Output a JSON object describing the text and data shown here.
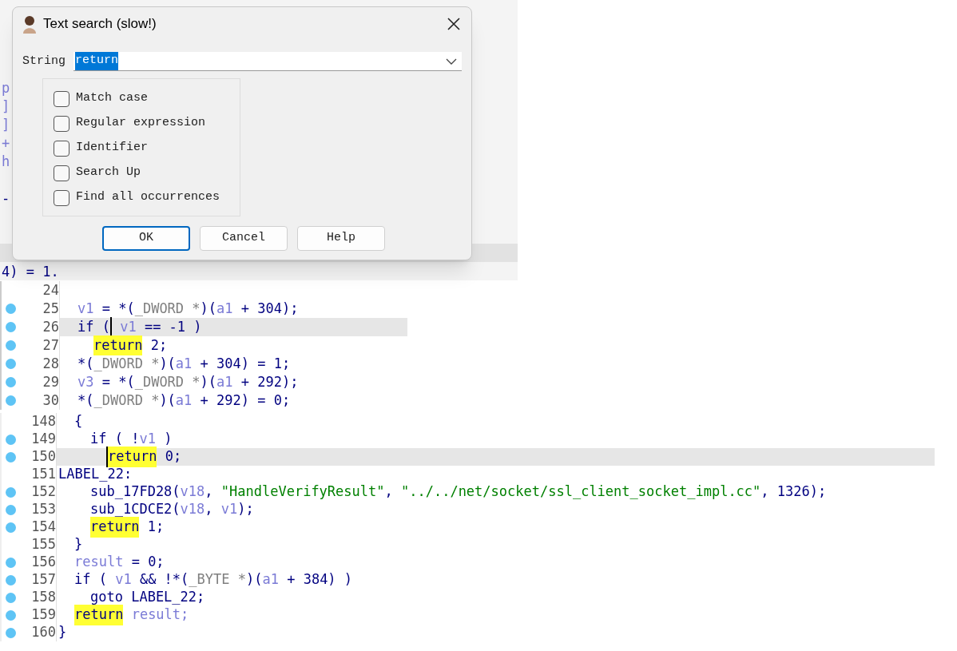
{
  "background_code": [
    {
      "kind": "blank"
    },
    {
      "kind": "blank"
    },
    {
      "kind": "blank"
    },
    {
      "kind": "blank"
    },
    {
      "kind": "var",
      "text": "p"
    },
    {
      "kind": "var",
      "text": "]"
    },
    {
      "kind": "var",
      "text": "]"
    },
    {
      "kind": "var",
      "text": "+"
    },
    {
      "kind": "var",
      "text": "h"
    },
    {
      "kind": "blank"
    },
    {
      "kind": "code",
      "text": "-"
    },
    {
      "kind": "blank"
    },
    {
      "kind": "blank"
    },
    {
      "kind": "current"
    },
    {
      "kind": "code",
      "text": "4) = 1."
    }
  ],
  "dialog": {
    "title": "Text search (slow!)",
    "string_label": "String",
    "string_value": "return",
    "options": [
      {
        "label": "Match case",
        "checked": false
      },
      {
        "label": "Regular expression",
        "checked": false
      },
      {
        "label": "Identifier",
        "checked": false
      },
      {
        "label": "Search Up",
        "checked": false
      },
      {
        "label": "Find all occurrences",
        "checked": false
      }
    ],
    "buttons": [
      {
        "label": "OK",
        "default": true
      },
      {
        "label": "Cancel",
        "default": false
      },
      {
        "label": "Help",
        "default": false
      }
    ]
  },
  "code_panels": [
    {
      "lines": [
        {
          "number": "24",
          "dot": false,
          "current": false
        },
        {
          "number": "25",
          "dot": true,
          "current": false,
          "kind": "single",
          "tokens": [
            {
              "t": "v1",
              "kind": "var"
            },
            {
              "t": " = *(",
              "kind": "code"
            },
            {
              "t": "_DWORD *",
              "kind": "type"
            },
            {
              "t": ")(",
              "kind": "code"
            },
            {
              "t": "a1",
              "kind": "var"
            },
            {
              "t": " + 304);",
              "kind": "code"
            }
          ]
        },
        {
          "number": "26",
          "dot": true,
          "current": true,
          "kind": "single",
          "tokens": [
            {
              "t": "if (",
              "kind": "code",
              "caret": false
            },
            {
              "t": " v1",
              "kind": "var",
              "caret": true
            },
            {
              "t": " == -1 )",
              "kind": "code",
              "caret": false
            }
          ]
        },
        {
          "number": "27",
          "dot": true,
          "current": false,
          "kind": "double",
          "tokens": [
            {
              "t": "return",
              "kind": "hit"
            },
            {
              "t": " 2;",
              "kind": "code"
            }
          ]
        },
        {
          "number": "28",
          "dot": true,
          "current": false,
          "kind": "single",
          "tokens": [
            {
              "t": "*(",
              "kind": "code"
            },
            {
              "t": "_DWORD *",
              "kind": "type"
            },
            {
              "t": ")(",
              "kind": "code"
            },
            {
              "t": "a1",
              "kind": "var"
            },
            {
              "t": " + 304) = 1;",
              "kind": "code"
            }
          ]
        },
        {
          "number": "29",
          "dot": true,
          "current": false,
          "kind": "single",
          "tokens": [
            {
              "t": "v3",
              "kind": "var"
            },
            {
              "t": " = *(",
              "kind": "code"
            },
            {
              "t": "_DWORD *",
              "kind": "type"
            },
            {
              "t": ")(",
              "kind": "code"
            },
            {
              "t": "a1",
              "kind": "var"
            },
            {
              "t": " + 292);",
              "kind": "code"
            }
          ]
        },
        {
          "number": "30",
          "dot": true,
          "current": false,
          "kind": "single",
          "tokens": [
            {
              "t": "*(",
              "kind": "code"
            },
            {
              "t": "_DWORD *",
              "kind": "type"
            },
            {
              "t": ")(",
              "kind": "code"
            },
            {
              "t": "a1",
              "kind": "var"
            },
            {
              "t": " + 292) = 0;",
              "kind": "code"
            }
          ]
        }
      ]
    },
    {
      "lines": [
        {
          "number": "148",
          "dot": false,
          "current": false,
          "kind": "single",
          "tokens": [
            {
              "t": "{",
              "kind": "code"
            }
          ]
        },
        {
          "number": "149",
          "dot": true,
          "current": false,
          "kind": "double",
          "tokens": [
            {
              "t": "if ( !",
              "kind": "code"
            },
            {
              "t": "v1",
              "kind": "var"
            },
            {
              "t": " )",
              "kind": "code"
            }
          ]
        },
        {
          "number": "150",
          "dot": true,
          "current": true,
          "kind": "triple",
          "tokens": [
            {
              "t": "return",
              "kind": "hit",
              "caret": true
            },
            {
              "t": " 0;",
              "kind": "code",
              "caret": false
            }
          ]
        },
        {
          "number": "151",
          "dot": false,
          "current": false,
          "kind": "flush",
          "tokens": [
            {
              "t": "LABEL_22:",
              "kind": "code"
            }
          ]
        },
        {
          "number": "152",
          "dot": true,
          "current": false,
          "kind": "double",
          "tokens": [
            {
              "t": "sub_17FD28(",
              "kind": "code"
            },
            {
              "t": "v18",
              "kind": "var"
            },
            {
              "t": ", ",
              "kind": "code"
            },
            {
              "t": "\"HandleVerifyResult\"",
              "kind": "str"
            },
            {
              "t": ", ",
              "kind": "code"
            },
            {
              "t": "\"../../net/socket/ssl_client_socket_impl.cc\"",
              "kind": "str"
            },
            {
              "t": ", 1326);",
              "kind": "code"
            }
          ]
        },
        {
          "number": "153",
          "dot": true,
          "current": false,
          "kind": "double",
          "tokens": [
            {
              "t": "sub_1CDCE2(",
              "kind": "code"
            },
            {
              "t": "v18",
              "kind": "var"
            },
            {
              "t": ", ",
              "kind": "code"
            },
            {
              "t": "v1",
              "kind": "var"
            },
            {
              "t": ");",
              "kind": "code"
            }
          ]
        },
        {
          "number": "154",
          "dot": true,
          "current": false,
          "kind": "double",
          "tokens": [
            {
              "t": "return",
              "kind": "hit"
            },
            {
              "t": " 1;",
              "kind": "code"
            }
          ]
        },
        {
          "number": "155",
          "dot": false,
          "current": false,
          "kind": "single",
          "tokens": [
            {
              "t": "}",
              "kind": "code"
            }
          ]
        },
        {
          "number": "156",
          "dot": true,
          "current": false,
          "kind": "single",
          "tokens": [
            {
              "t": "result",
              "kind": "var"
            },
            {
              "t": " = 0;",
              "kind": "code"
            }
          ]
        },
        {
          "number": "157",
          "dot": true,
          "current": false,
          "kind": "single",
          "tokens": [
            {
              "t": "if ( ",
              "kind": "code"
            },
            {
              "t": "v1",
              "kind": "var"
            },
            {
              "t": " && !*(",
              "kind": "code"
            },
            {
              "t": "_BYTE *",
              "kind": "type"
            },
            {
              "t": ")(",
              "kind": "code"
            },
            {
              "t": "a1",
              "kind": "var"
            },
            {
              "t": " + 384) )",
              "kind": "code"
            }
          ]
        },
        {
          "number": "158",
          "dot": true,
          "current": false,
          "kind": "double",
          "tokens": [
            {
              "t": "goto LABEL_22;",
              "kind": "code"
            }
          ]
        },
        {
          "number": "159",
          "dot": true,
          "current": false,
          "kind": "single",
          "tokens": [
            {
              "t": "return",
              "kind": "hit"
            },
            {
              "t": " result;",
              "kind": "var"
            }
          ]
        },
        {
          "number": "160",
          "dot": true,
          "current": false,
          "kind": "flush",
          "tokens": [
            {
              "t": "}",
              "kind": "code"
            }
          ]
        }
      ]
    }
  ]
}
